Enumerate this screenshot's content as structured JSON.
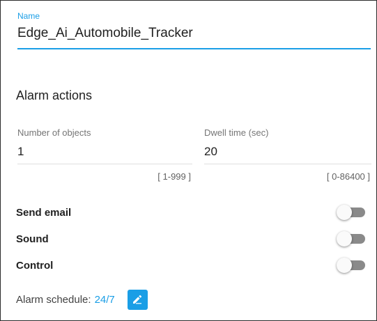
{
  "name_field": {
    "label": "Name",
    "value": "Edge_Ai_Automobile_Tracker"
  },
  "alarm_actions": {
    "title": "Alarm actions",
    "number_of_objects": {
      "label": "Number of objects",
      "value": "1",
      "range": "[ 1-999 ]"
    },
    "dwell_time": {
      "label": "Dwell time (sec)",
      "value": "20",
      "range": "[ 0-86400 ]"
    }
  },
  "toggles": {
    "send_email": {
      "label": "Send email",
      "on": false
    },
    "sound": {
      "label": "Sound",
      "on": false
    },
    "control": {
      "label": "Control",
      "on": false
    }
  },
  "schedule": {
    "label": "Alarm schedule:",
    "value": "24/7",
    "edit_icon": "pencil-icon"
  },
  "colors": {
    "accent": "#1a9ee6",
    "switch_off_track": "#8a8a8a",
    "switch_thumb": "#fafafa"
  }
}
